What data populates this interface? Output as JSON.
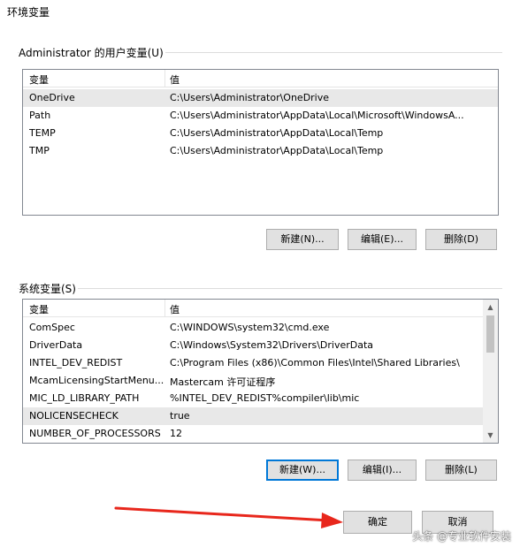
{
  "window": {
    "title": "环境变量"
  },
  "user_vars": {
    "label": "Administrator 的用户变量(U)",
    "columns": [
      "变量",
      "值"
    ],
    "rows": [
      {
        "name": "OneDrive",
        "value": "C:\\Users\\Administrator\\OneDrive"
      },
      {
        "name": "Path",
        "value": "C:\\Users\\Administrator\\AppData\\Local\\Microsoft\\WindowsA..."
      },
      {
        "name": "TEMP",
        "value": "C:\\Users\\Administrator\\AppData\\Local\\Temp"
      },
      {
        "name": "TMP",
        "value": "C:\\Users\\Administrator\\AppData\\Local\\Temp"
      }
    ],
    "buttons": {
      "new": "新建(N)...",
      "edit": "编辑(E)...",
      "delete": "删除(D)"
    }
  },
  "system_vars": {
    "label": "系统变量(S)",
    "columns": [
      "变量",
      "值"
    ],
    "rows": [
      {
        "name": "ComSpec",
        "value": "C:\\WINDOWS\\system32\\cmd.exe"
      },
      {
        "name": "DriverData",
        "value": "C:\\Windows\\System32\\Drivers\\DriverData"
      },
      {
        "name": "INTEL_DEV_REDIST",
        "value": "C:\\Program Files (x86)\\Common Files\\Intel\\Shared Libraries\\"
      },
      {
        "name": "McamLicensingStartMenu...",
        "value": "Mastercam 许可证程序"
      },
      {
        "name": "MIC_LD_LIBRARY_PATH",
        "value": "%INTEL_DEV_REDIST%compiler\\lib\\mic"
      },
      {
        "name": "NOLICENSECHECK",
        "value": "true"
      },
      {
        "name": "NUMBER_OF_PROCESSORS",
        "value": "12"
      }
    ],
    "buttons": {
      "new": "新建(W)...",
      "edit": "编辑(I)...",
      "delete": "删除(L)"
    }
  },
  "footer": {
    "ok": "确定",
    "cancel": "取消"
  },
  "watermark": "头条 @专业软件安装",
  "colors": {
    "arrow": "#e8271c",
    "default_button_border": "#0078d7",
    "button_face": "#e1e1e1"
  }
}
